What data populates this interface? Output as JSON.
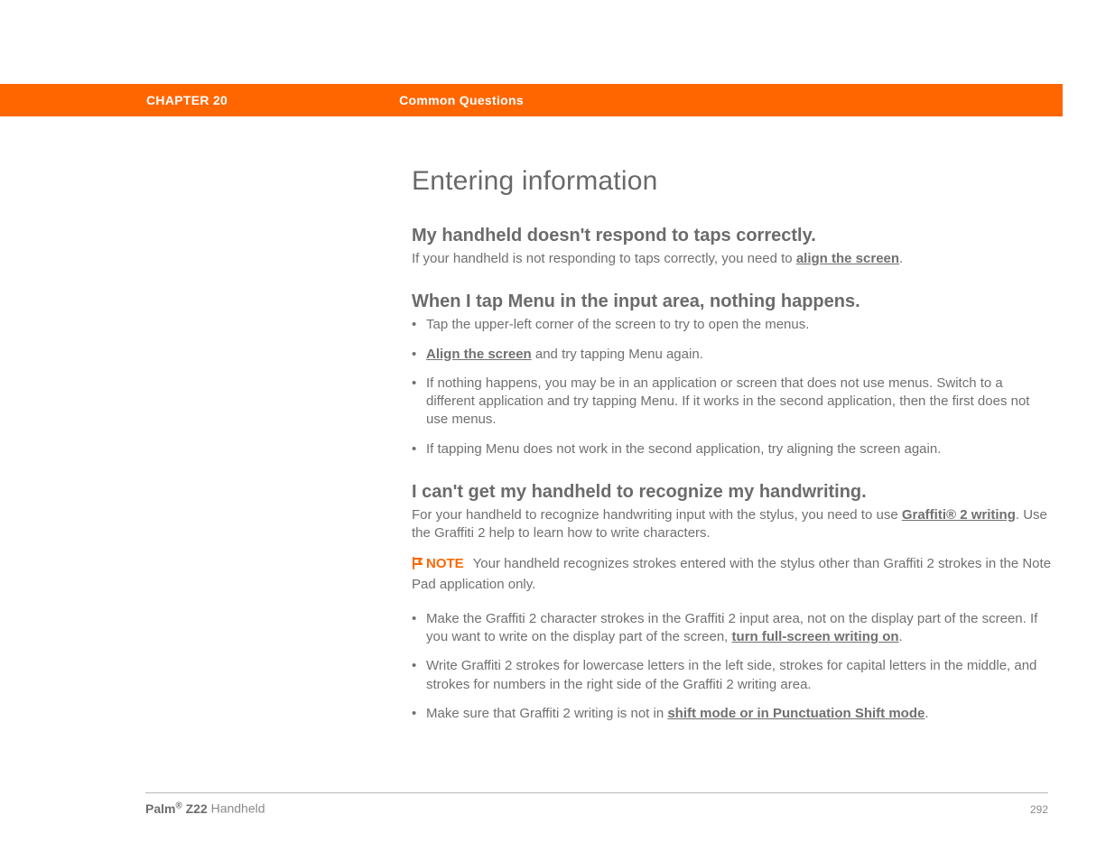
{
  "header": {
    "chapter": "CHAPTER 20",
    "section": "Common Questions"
  },
  "title": "Entering information",
  "q1": {
    "heading": "My handheld doesn't respond to taps correctly.",
    "text_before": "If your handheld is not responding to taps correctly, you need to ",
    "link": "align the screen",
    "text_after": "."
  },
  "q2": {
    "heading": "When I tap Menu in the input area, nothing happens.",
    "b1": "Tap the upper-left corner of the screen to try to open the menus.",
    "b2_link": "Align the screen",
    "b2_after": " and try tapping Menu again.",
    "b3": "If nothing happens, you may be in an application or screen that does not use menus. Switch to a different application and try tapping Menu. If it works in the second application, then the first does not use menus.",
    "b4": "If tapping Menu does not work in the second application, try aligning the screen again."
  },
  "q3": {
    "heading": "I can't get my handheld to recognize my handwriting.",
    "p1_before": "For your handheld to recognize handwriting input with the stylus, you need to use ",
    "p1_link": "Graffiti® 2 writing",
    "p1_after": ". Use the Graffiti 2 help to learn how to write characters.",
    "note_label": "NOTE",
    "note_text": "Your handheld recognizes strokes entered with the stylus other than Graffiti 2 strokes in the Note Pad application only.",
    "b1_before": "Make the Graffiti 2 character strokes in the Graffiti 2 input area, not on the display part of the screen. If you want to write on the display part of the screen, ",
    "b1_link": "turn full-screen writing on",
    "b1_after": ".",
    "b2": "Write Graffiti 2 strokes for lowercase letters in the left side, strokes for capital letters in the middle, and strokes for numbers in the right side of the Graffiti 2 writing area.",
    "b3_before": "Make sure that Graffiti 2 writing is not in ",
    "b3_link": "shift mode or in Punctuation Shift mode",
    "b3_after": "."
  },
  "footer": {
    "brand_before": "Palm",
    "brand_model": " Z22",
    "brand_after": " Handheld",
    "page": "292"
  }
}
